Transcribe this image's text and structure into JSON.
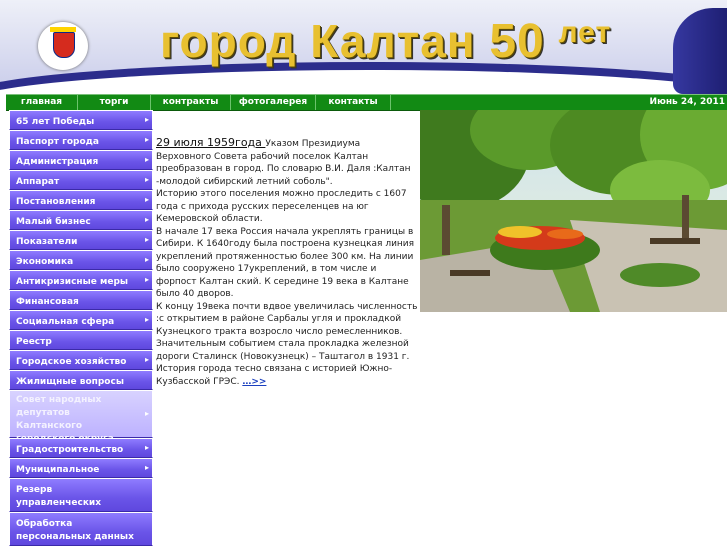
{
  "header": {
    "title_word1": "город Калтан",
    "title_num": "50",
    "title_word2": "лет"
  },
  "nav": {
    "items": [
      "главная",
      "торги",
      "контракты",
      "фотогалерея",
      "контакты"
    ],
    "date": "Июнь 24, 2011"
  },
  "sidebar": {
    "items": [
      {
        "label": "65 лет Победы",
        "arrow": true
      },
      {
        "label": "Паспорт города",
        "arrow": true
      },
      {
        "label": "Администрация города",
        "arrow": true
      },
      {
        "label": "Аппарат администрации",
        "arrow": true
      },
      {
        "label": "Постановления",
        "arrow": true
      },
      {
        "label": "Малый бизнес",
        "arrow": true
      },
      {
        "label": "Показатели эффективности",
        "arrow": true
      },
      {
        "label": "Экономика",
        "arrow": true
      },
      {
        "label": "Антикризисные меры",
        "arrow": true
      },
      {
        "label": "Финансовая грамотность",
        "arrow": false
      },
      {
        "label": "Социальная сфера",
        "arrow": true
      },
      {
        "label": "Реестр муниципальных услуг",
        "arrow": false
      },
      {
        "label": "Городское хозяйство",
        "arrow": true
      },
      {
        "label": "Жилищные вопросы",
        "arrow": false
      },
      {
        "label": "Совет народных депутатов Калтанского городского округа",
        "arrow": true
      },
      {
        "label": "Градостроительство",
        "arrow": true
      },
      {
        "label": "Муниципальное имущество",
        "arrow": true
      },
      {
        "label": "Резерв управленческих кадров",
        "arrow": false
      },
      {
        "label": "Обработка персональных данных",
        "arrow": false
      }
    ],
    "arrow_glyph": "▸"
  },
  "content": {
    "date_underlined": "29 июля   1959года    ",
    "para1": " Указом Президиума Верховного Совета рабочий поселок Калтан преобразован в город. По словарю В.И. Даля :Калтан -молодой сибирский летний соболь\".",
    "para2": "Историю этого поселения можно проследить с 1607 года с прихода русских переселенцев на юг Кемеровской области.",
    "para3": "В начале 17 века Россия начала укреплять границы в Сибири. К 1640году была построена кузнецкая линия укреплений протяженностью более 300 км. На линии было сооружено 17укреплений, в том числе и форпост Калтан ский. К середине 19 века в Калтане было 40 дворов.",
    "para4": "К концу 19века почти вдвое увеличилась численность :с открытием в районе Сарбалы угля и прокладкой Кузнецкого тракта возросло число ремесленников.",
    "para5": "Значительным событием стала прокладка железной дороги Сталинск (Новокузнецк) – Таштагол в 1931 г.",
    "para6": "История города тесно связана с историей Южно-Кузбасской ГРЭС. ",
    "more": "…>>"
  },
  "colors": {
    "nav_green": "#128a14",
    "menu_purple": "#6a54e8",
    "title_gold": "#e8c030",
    "header_navy": "#2c2d8c"
  }
}
